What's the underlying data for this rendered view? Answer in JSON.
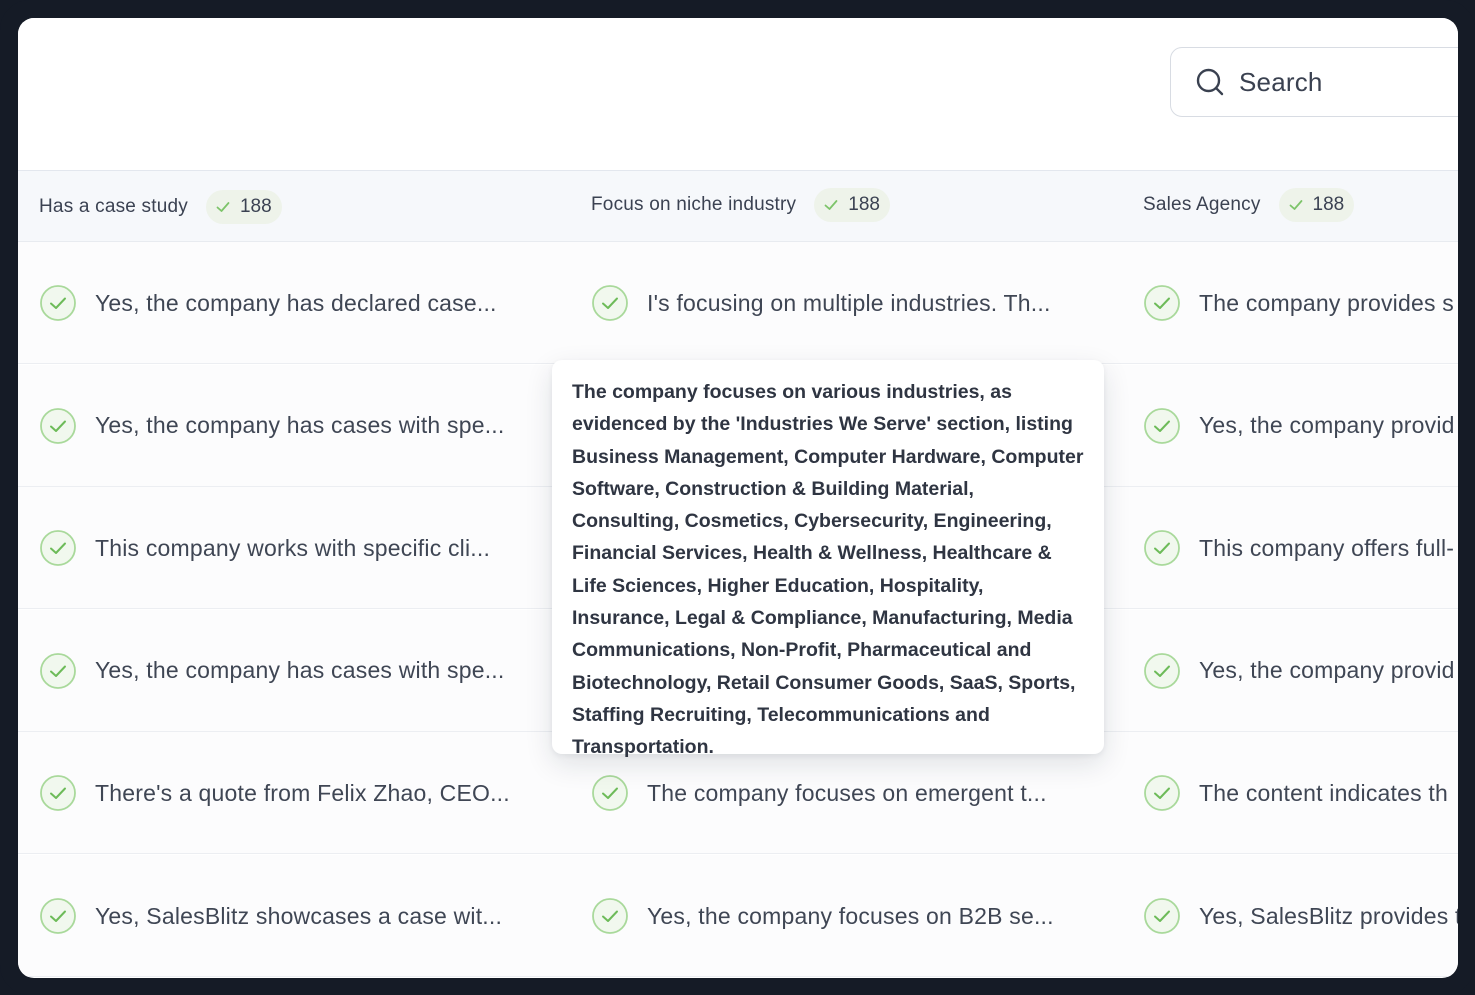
{
  "search": {
    "placeholder": "Search"
  },
  "columns": [
    {
      "label": "Has a case study",
      "count": "188"
    },
    {
      "label": "Focus on niche industry",
      "count": "188"
    },
    {
      "label": "Sales Agency",
      "count": "188"
    }
  ],
  "rows": [
    [
      "Yes, the company has declared case...",
      "I's focusing on multiple industries. Th...",
      "The company provides s"
    ],
    [
      "Yes, the company has cases with spe...",
      "",
      "Yes, the company provid"
    ],
    [
      "This company works with specific cli...",
      "",
      "This company offers full-"
    ],
    [
      "Yes, the company has cases with spe...",
      "",
      "Yes, the company provid"
    ],
    [
      "There's a quote from Felix Zhao, CEO...",
      "The company focuses on emergent t...",
      "The content indicates th"
    ],
    [
      "Yes, SalesBlitz showcases a case wit...",
      "Yes, the company focuses on B2B se...",
      "Yes, SalesBlitz provides t"
    ]
  ],
  "tooltip": {
    "text": "The company focuses on various industries, as evidenced by the 'Industries We Serve' section, listing Business Management, Computer Hardware, Computer Software, Construction & Building Material, Consulting, Cosmetics, Cybersecurity, Engineering, Financial Services, Health & Wellness, Healthcare & Life Sciences, Higher Education, Hospitality, Insurance, Legal & Compliance, Manufacturing, Media Communications, Non-Profit, Pharmaceutical and Biotechnology, Retail Consumer Goods, SaaS, Sports, Staffing Recruiting, Telecommunications and Transportation."
  },
  "colors": {
    "check_green": "#7dc46a",
    "check_circle_fill": "#f1f8ee",
    "frame": "#151b26"
  }
}
